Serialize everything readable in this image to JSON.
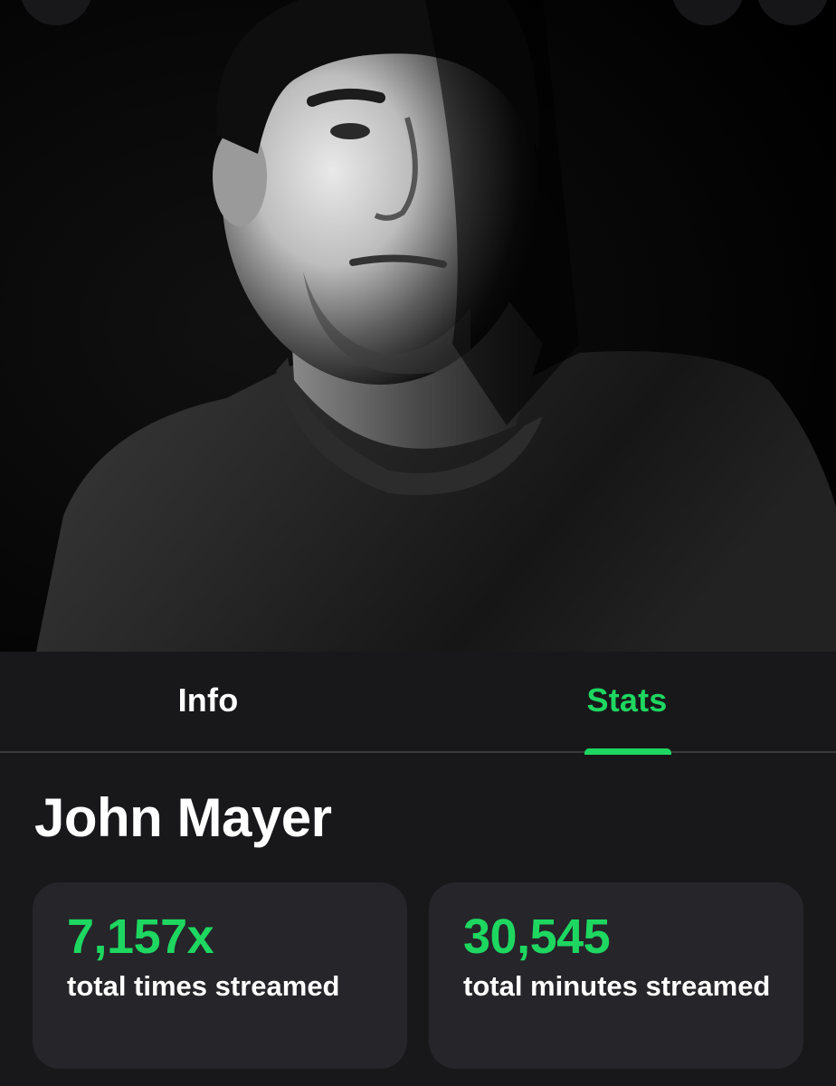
{
  "artist": {
    "name": "John Mayer",
    "photo_alt": "John Mayer"
  },
  "header": {
    "back_icon": "chevron-left-icon",
    "share_icon": "share-icon",
    "more_icon": "more-icon"
  },
  "tabs": [
    {
      "label": "Info",
      "active": false
    },
    {
      "label": "Stats",
      "active": true
    }
  ],
  "stats": [
    {
      "value": "7,157x",
      "caption": "total times streamed"
    },
    {
      "value": "30,545",
      "caption": "total minutes streamed"
    }
  ],
  "colors": {
    "accent": "#1ed760",
    "background": "#18181b",
    "card": "#25252a",
    "divider": "#3a3a3e"
  }
}
